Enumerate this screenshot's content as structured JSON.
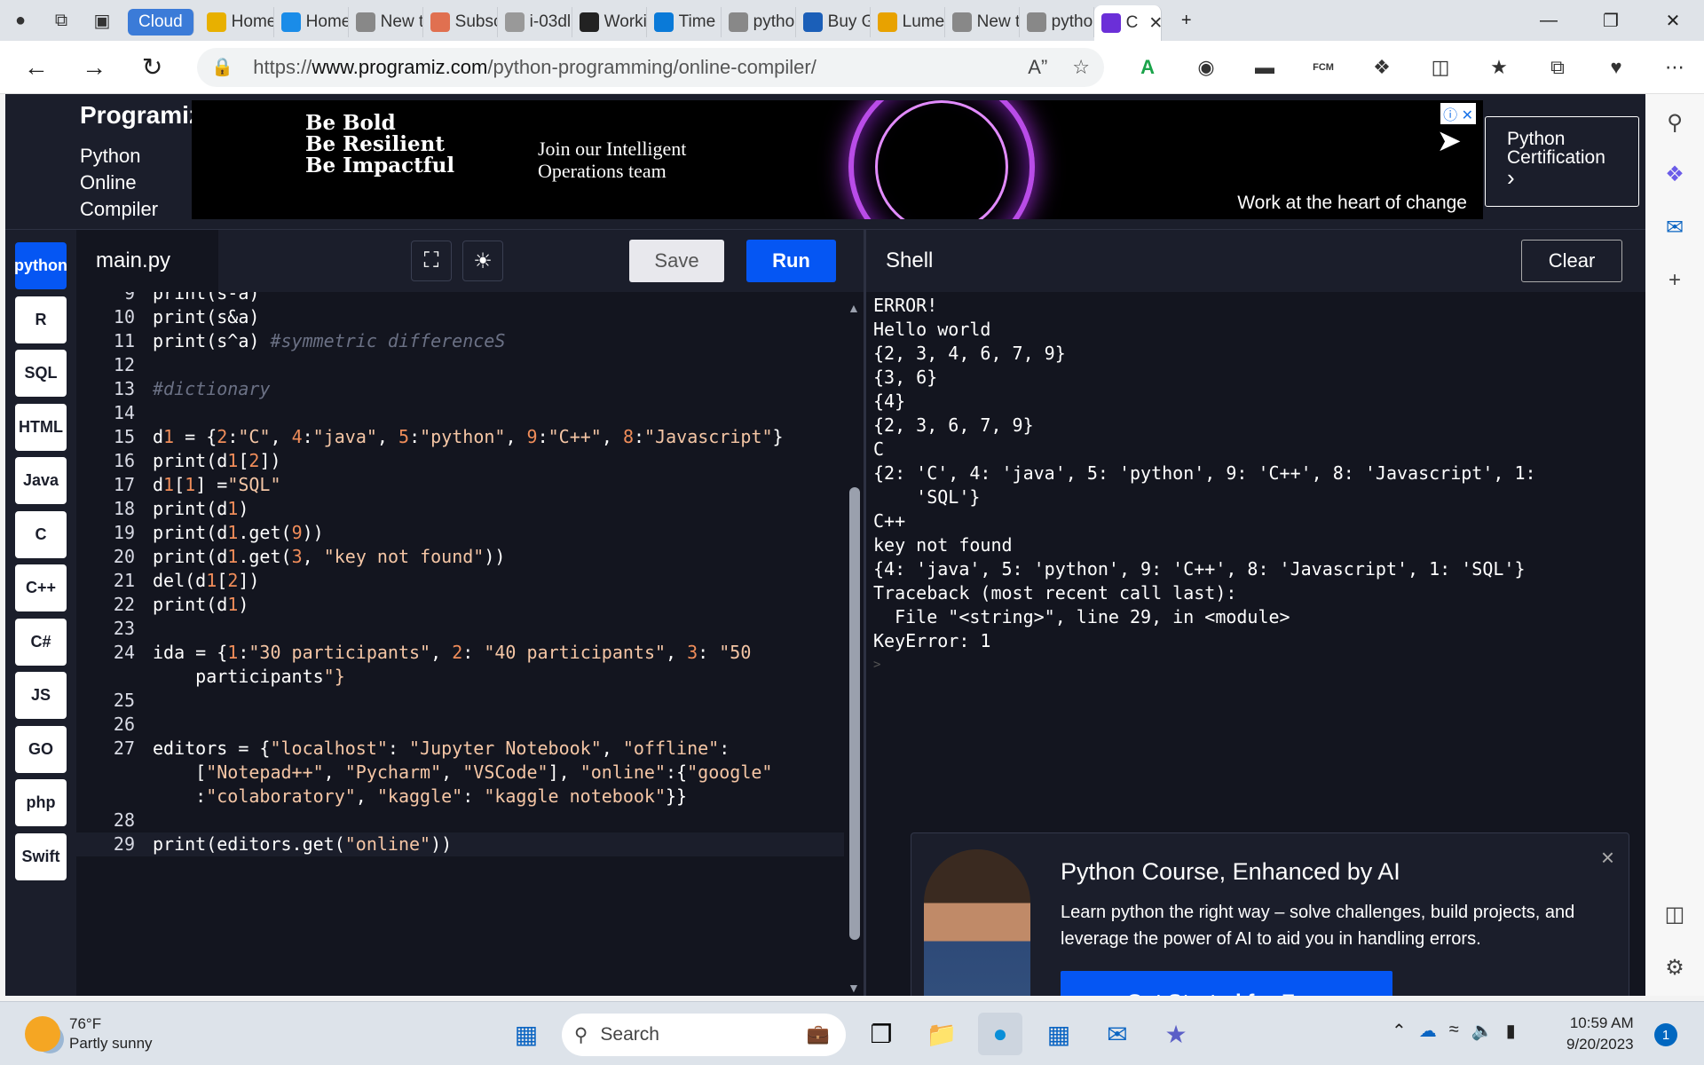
{
  "browser": {
    "tabs": [
      {
        "label": "Cloud",
        "type": "cloud"
      },
      {
        "label": "Home",
        "icon": "shell-icon",
        "color": "#e8b000"
      },
      {
        "label": "Home",
        "icon": "cloud-icon",
        "color": "#1a8ce8"
      },
      {
        "label": "New t",
        "icon": "page-icon",
        "color": "#888"
      },
      {
        "label": "Subsc",
        "icon": "arc-icon",
        "color": "#e07050"
      },
      {
        "label": "i-03dl",
        "icon": "window-icon",
        "color": "#999"
      },
      {
        "label": "Worki",
        "icon": "edge-icon",
        "color": "#222"
      },
      {
        "label": "Time",
        "icon": "time-icon",
        "color": "#0a7ad8"
      },
      {
        "label": "pytho",
        "icon": "search-icon",
        "color": "#888"
      },
      {
        "label": "Buy G",
        "icon": "de-icon",
        "color": "#1b5fb8"
      },
      {
        "label": "Lume",
        "icon": "lume-icon",
        "color": "#e8a200"
      },
      {
        "label": "New t",
        "icon": "page-icon",
        "color": "#888"
      },
      {
        "label": "pytho",
        "icon": "search-icon",
        "color": "#888"
      },
      {
        "label": "C",
        "icon": "programiz-icon",
        "color": "#6b2fd8"
      }
    ],
    "url_prefix": "https://",
    "url_host": "www.programiz.com",
    "url_path": "/python-programming/online-compiler/"
  },
  "site": {
    "logo": "Programiz",
    "subtitle": "Python Online Compiler",
    "cert_label": "Python Certification",
    "cert_arrow": "›"
  },
  "ad": {
    "lines": [
      "Be Bold",
      "Be Resilient",
      "Be Impactful"
    ],
    "join": "Join our Intelligent Operations team",
    "tagline": "Work at the heart of change"
  },
  "languages": [
    "python",
    "R",
    "SQL",
    "HTML",
    "Java",
    "C",
    "C++",
    "C#",
    "JS",
    "GO",
    "php",
    "Swift"
  ],
  "editor": {
    "filename": "main.py",
    "save_label": "Save",
    "run_label": "Run",
    "fullscreen_icon": "fullscreen-icon",
    "theme_icon": "sun-icon",
    "lines": [
      {
        "n": "9",
        "t": "print(s-a)"
      },
      {
        "n": "10",
        "t": "print(s&a)"
      },
      {
        "n": "11",
        "t": "print(s^a) #symmetric differenceS"
      },
      {
        "n": "12",
        "t": ""
      },
      {
        "n": "13",
        "t": "#dictionary"
      },
      {
        "n": "14",
        "t": ""
      },
      {
        "n": "15",
        "t": "d1 = {2:\"C\", 4:\"java\", 5:\"python\", 9:\"C++\", 8:\"Javascript\"}"
      },
      {
        "n": "16",
        "t": "print(d1[2])"
      },
      {
        "n": "17",
        "t": "d1[1] =\"SQL\""
      },
      {
        "n": "18",
        "t": "print(d1)"
      },
      {
        "n": "19",
        "t": "print(d1.get(9))"
      },
      {
        "n": "20",
        "t": "print(d1.get(3, \"key not found\"))"
      },
      {
        "n": "21",
        "t": "del(d1[2])"
      },
      {
        "n": "22",
        "t": "print(d1)"
      },
      {
        "n": "23",
        "t": ""
      },
      {
        "n": "24",
        "t": "ida = {1:\"30 participants\", 2: \"40 participants\", 3: \"50"
      },
      {
        "n": "",
        "t": "    participants\"}"
      },
      {
        "n": "25",
        "t": ""
      },
      {
        "n": "26",
        "t": ""
      },
      {
        "n": "27",
        "t": "editors = {\"localhost\": \"Jupyter Notebook\", \"offline\":"
      },
      {
        "n": "",
        "t": "    [\"Notepad++\", \"Pycharm\", \"VSCode\"], \"online\":{\"google\""
      },
      {
        "n": "",
        "t": "    :\"colaboratory\", \"kaggle\": \"kaggle notebook\"}}"
      },
      {
        "n": "28",
        "t": ""
      },
      {
        "n": "29",
        "t": "print(editors.get(\"online\"))"
      }
    ]
  },
  "shell": {
    "title": "Shell",
    "clear_label": "Clear",
    "output": [
      "ERROR!",
      "Hello world",
      "{2, 3, 4, 6, 7, 9}",
      "{3, 6}",
      "{4}",
      "{2, 3, 6, 7, 9}",
      "C",
      "{2: 'C', 4: 'java', 5: 'python', 9: 'C++', 8: 'Javascript', 1:",
      "    'SQL'}",
      "C++",
      "key not found",
      "{4: 'java', 5: 'python', 9: 'C++', 8: 'Javascript', 1: 'SQL'}",
      "Traceback (most recent call last):",
      "  File \"<string>\", line 29, in <module>",
      "KeyError: 1",
      ">"
    ]
  },
  "promo": {
    "title": "Python Course, Enhanced by AI",
    "text": "Learn python the right way – solve challenges, build projects, and leverage the power of AI to aid you in handling errors.",
    "button": "Get Started for Free",
    "close": "×"
  },
  "taskbar": {
    "temp": "76°F",
    "weather": "Partly sunny",
    "search_label": "Search",
    "time": "10:59 AM",
    "date": "9/20/2023",
    "badge": "1"
  }
}
